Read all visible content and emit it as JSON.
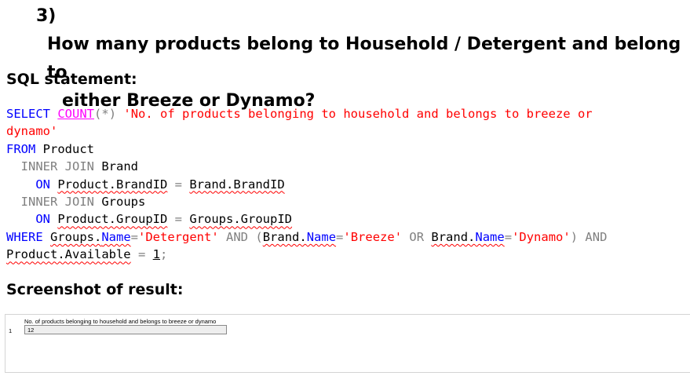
{
  "question": {
    "number": "3)",
    "line1": "How many products belong to Household / Detergent and belong to",
    "line2": "either Breeze or Dynamo?"
  },
  "sql_heading": "SQL statement:",
  "sql": {
    "select": "SELECT",
    "count": "COUNT",
    "paren_open": "(",
    "star": "*",
    "paren_close": ")",
    "alias_part1": "'No. of products belonging to household and belongs to breeze or",
    "alias_part2": "dynamo'",
    "from": "FROM",
    "product": "Product",
    "inner_join": "INNER JOIN",
    "brand": "Brand",
    "on": "ON",
    "join1_left": "Product.BrandID",
    "equals": "=",
    "join1_right": "Brand.BrandID",
    "groups": "Groups",
    "join2_left": "Product.GroupID",
    "join2_right": "Groups.GroupID",
    "where": "WHERE",
    "groups_prefix": "Groups.",
    "name_col": "Name",
    "detergent": "'Detergent'",
    "and": "AND",
    "brand_prefix": "Brand.",
    "breeze": "'Breeze'",
    "or": "OR",
    "dynamo": "'Dynamo'",
    "product_available": "Product.Available",
    "one": "1",
    "semicolon": ";"
  },
  "screenshot_heading": "Screenshot of result:",
  "result_grid": {
    "column_header": "No. of products belonging to household and belongs to breeze or dynamo",
    "row_number": "1",
    "value": "12"
  }
}
